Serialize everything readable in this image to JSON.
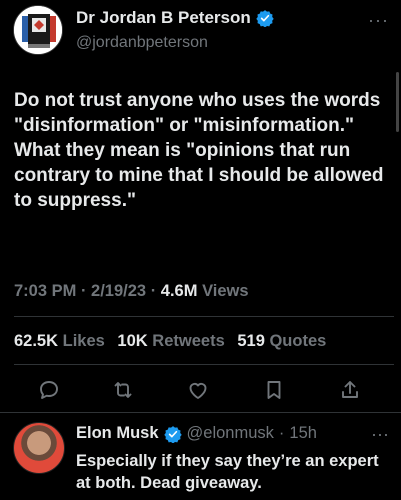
{
  "tweet": {
    "display_name": "Dr Jordan B Peterson",
    "handle": "@jordanbpeterson",
    "more_label": "···",
    "text": "Do not trust anyone who uses the words \"disinformation\" or \"misinformation.\"\nWhat they mean is \"opinions that run contrary to mine that I should be allowed to suppress.\"",
    "time": "7:03 PM",
    "date": "2/19/23",
    "views_count": "4.6M",
    "views_label": "Views",
    "sep": "·",
    "likes_count": "62.5K",
    "likes_label": "Likes",
    "retweets_count": "10K",
    "retweets_label": "Retweets",
    "quotes_count": "519",
    "quotes_label": "Quotes"
  },
  "actions": {
    "icons": [
      "reply-icon",
      "retweet-icon",
      "like-icon",
      "bookmark-icon",
      "share-icon"
    ]
  },
  "reply": {
    "display_name": "Elon Musk",
    "handle": "@elonmusk",
    "sep": "·",
    "age": "15h",
    "more_label": "···",
    "text": "Especially if they say they’re an expert at both. Dead giveaway."
  },
  "colors": {
    "background": "#000000",
    "text": "#e7e9ea",
    "muted": "#71767b",
    "verified": "#1d9bf0",
    "divider": "#2f3336"
  }
}
